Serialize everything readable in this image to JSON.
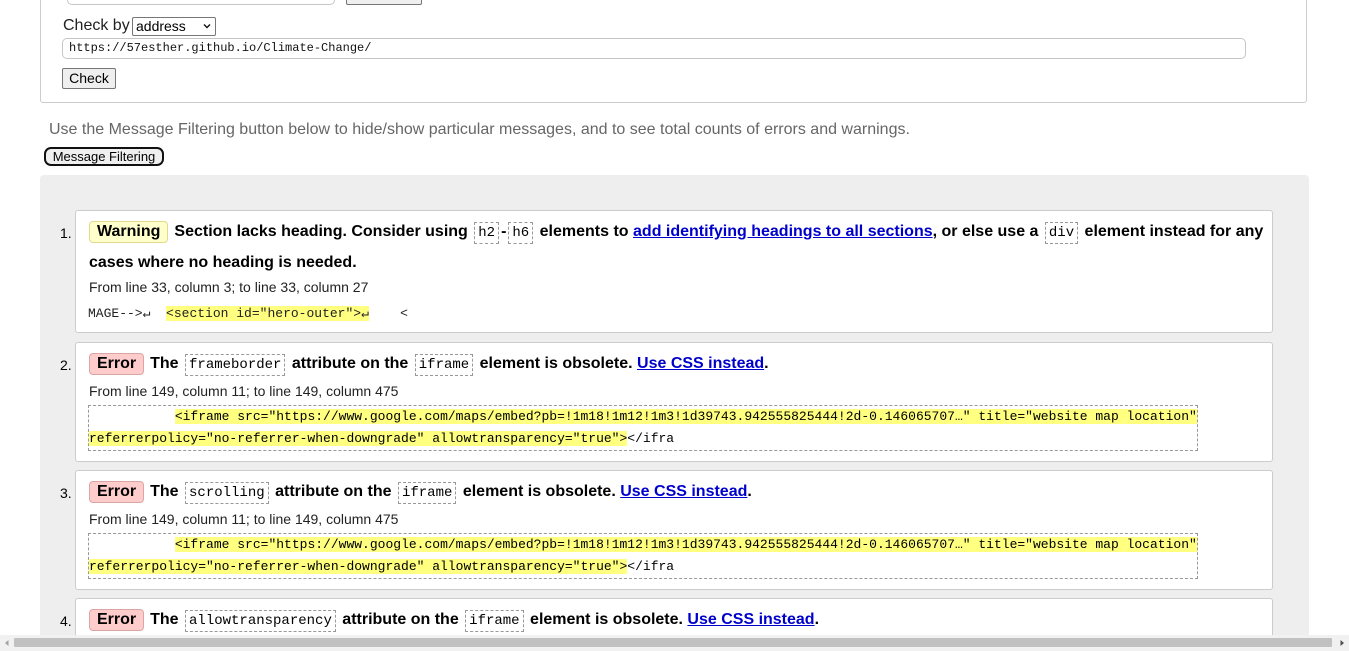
{
  "form": {
    "check_by_label": "Check by",
    "check_by_value": "address",
    "url_value": "https://57esther.github.io/Climate-Change/",
    "check_button": "Check"
  },
  "filter": {
    "note": "Use the Message Filtering button below to hide/show particular messages, and to see total counts of errors and warnings.",
    "button": "Message Filtering"
  },
  "messages": [
    {
      "num": "1.",
      "type": "Warning",
      "t1": "Section lacks heading. Consider using ",
      "c1": "h2",
      "dash": "-",
      "c2": "h6",
      "t2": " elements to ",
      "link": "add identifying headings to all sections",
      "t3": ", or else use a ",
      "c3": "div",
      "t4": " element instead for any cases where no heading is needed.",
      "location": "From line 33, column 3; to line 33, column 27",
      "extract_pre": "MAGE-->↵  ",
      "extract_hl": "<section id=\"hero-outer\">↵",
      "extract_post": "    <"
    },
    {
      "num": "2.",
      "type": "Error",
      "t1": "The ",
      "c1": "frameborder",
      "t2": " attribute on the ",
      "c2": "iframe",
      "t3": " element is obsolete. ",
      "link": "Use CSS instead",
      "t4": ".",
      "location": "From line 149, column 11; to line 149, column 475",
      "ex1_pre": "           ",
      "ex1_hl": "<iframe src=\"https://www.google.com/maps/embed?pb=!1m18!1m12!1m3!1d39743.942555825444!2d-0.146065707…\" title=\"website map location\"",
      "ex2_hl": "referrerpolicy=\"no-referrer-when-downgrade\" allowtransparency=\"true\">",
      "ex2_post": "</ifra"
    },
    {
      "num": "3.",
      "type": "Error",
      "t1": "The ",
      "c1": "scrolling",
      "t2": " attribute on the ",
      "c2": "iframe",
      "t3": " element is obsolete. ",
      "link": "Use CSS instead",
      "t4": ".",
      "location": "From line 149, column 11; to line 149, column 475",
      "ex1_pre": "           ",
      "ex1_hl": "<iframe src=\"https://www.google.com/maps/embed?pb=!1m18!1m12!1m3!1d39743.942555825444!2d-0.146065707…\" title=\"website map location\"",
      "ex2_hl": "referrerpolicy=\"no-referrer-when-downgrade\" allowtransparency=\"true\">",
      "ex2_post": "</ifra"
    },
    {
      "num": "4.",
      "type": "Error",
      "t1": "The ",
      "c1": "allowtransparency",
      "t2": " attribute on the ",
      "c2": "iframe",
      "t3": " element is obsolete. ",
      "link": "Use CSS instead",
      "t4": "."
    }
  ]
}
